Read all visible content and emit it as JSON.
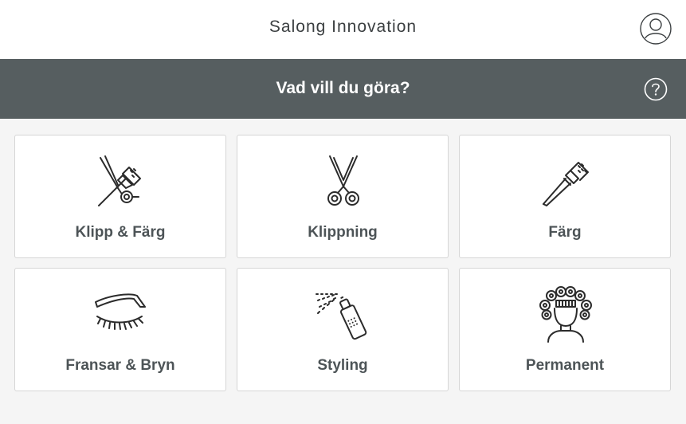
{
  "header": {
    "app_title": "Salong Innovation",
    "avatar_icon": "user-circle-icon"
  },
  "subheader": {
    "title": "Vad vill du göra?",
    "help_icon": "question-circle-icon"
  },
  "services": [
    {
      "label": "Klipp & Färg",
      "icon": "scissors-brush-icon"
    },
    {
      "label": "Klippning",
      "icon": "scissors-icon"
    },
    {
      "label": "Färg",
      "icon": "color-brush-icon"
    },
    {
      "label": "Fransar & Bryn",
      "icon": "eyelash-brow-icon"
    },
    {
      "label": "Styling",
      "icon": "spray-can-icon"
    },
    {
      "label": "Permanent",
      "icon": "perm-curlers-icon"
    }
  ],
  "colors": {
    "subbar_bg": "#565e60",
    "card_bg": "#ffffff",
    "page_bg": "#f5f5f5",
    "text": "#4d5457"
  }
}
